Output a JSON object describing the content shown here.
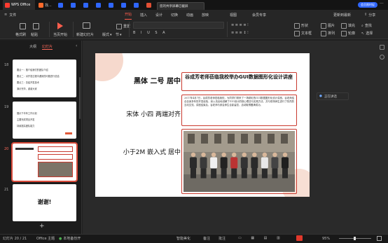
{
  "tabs": [
    {
      "label": "WPS Office",
      "color": "#ff3b30"
    },
    {
      "label": "找...",
      "color": "#ff6a2b"
    },
    {
      "label": "",
      "color": "#2f66ff"
    },
    {
      "label": "",
      "color": "#2f66ff"
    },
    {
      "label": "",
      "color": "#2f66ff"
    },
    {
      "label": "",
      "color": "#2f66ff"
    },
    {
      "label": "",
      "color": "#2f66ff"
    },
    {
      "label": "",
      "color": "#2f66ff"
    },
    {
      "label": "",
      "color": "#2f66ff"
    },
    {
      "label": "",
      "color": "#e14f34"
    }
  ],
  "top_right": {
    "badge": "会员限时促",
    "dots": "···"
  },
  "share_popup": {
    "line1": "您的共享屏幕已截屏",
    "line2": "放弃共享"
  },
  "menu": {
    "file": "文件",
    "items": [
      "开始",
      "插入",
      "设计",
      "切换",
      "动画",
      "放映",
      "视图",
      "会员专享"
    ],
    "active_index": 0,
    "update": "更新到最新",
    "share": "分享"
  },
  "ribbon": {
    "format_brush": "格式刷",
    "paste": "粘贴",
    "from_start": "当页开始",
    "new_slide": "新建幻灯片",
    "layout": "版式",
    "section": "节",
    "reset": "重置",
    "shape": "形状",
    "image": "图片",
    "fill": "填充",
    "find": "查找",
    "textbox": "文本框",
    "arrange": "排列",
    "outline": "轮廓",
    "select": "选择"
  },
  "panel": {
    "tab_outline": "大纲",
    "tab_slides": "幻灯片",
    "nums": [
      "18",
      "19",
      "20",
      "21"
    ],
    "t18": [
      "要点一：推介给我们的团队介绍",
      "要点二：对开发过程中遇到的问题进行总结",
      "要点三：总结开发技术",
      "演示完毕，谢谢大家"
    ],
    "t19": [
      "展示下半年工作计划",
      "主要完成项目开发",
      "持续提高团队能力"
    ],
    "t21": "谢谢!"
  },
  "slide": {
    "label1": "黑体 二号 居中",
    "label2": "宋体 小四 两端对齐",
    "label3": "小于2M 嵌入式 居中",
    "title": "谷成芳老师莅临我校举办GUI数据图形化设计讲座",
    "body": "2017年4月7日，谷成芳老师莅临我校，为同学们带来了一场精彩的GUI数据图形化设计讲座。谷老师结合自身多年的开发经验，深入浅出地讲解了GUI设计的核心理念与实践方法，并与现场师生进行了热烈的互动交流。讲座结束后，谷老师与参会师生合影留念，活动取得圆满成功。"
  },
  "side_label": "正在讲话",
  "status": {
    "slide_no": "幻灯片 20 / 21",
    "theme": "Office 主题",
    "local_backup": "本地备份开",
    "smart_beautify": "智能美化",
    "notes": "备注",
    "comment": "批注",
    "zoom": "95%"
  },
  "photo_people": 10
}
